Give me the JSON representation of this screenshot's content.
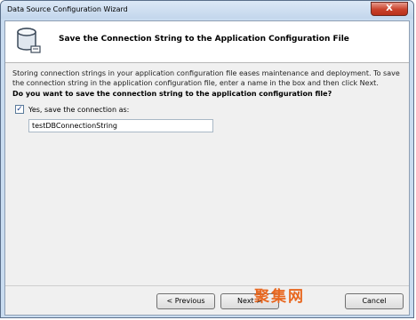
{
  "window": {
    "title": "Data Source Configuration Wizard",
    "close_glyph": "X"
  },
  "header": {
    "title": "Save the Connection String to the Application Configuration File",
    "icon": "database-icon"
  },
  "content": {
    "description": "Storing connection strings in your application configuration file eases maintenance and deployment. To save the connection string in the application configuration file, enter a name in the box and then click Next.",
    "question": "Do you want to save the connection string to the application configuration file?",
    "checkbox": {
      "checked": true,
      "mark": "✓",
      "label": "Yes, save the connection as:"
    },
    "connection_name": "testDBConnectionString"
  },
  "buttons": {
    "previous": "< Previous",
    "next": "Next >",
    "cancel": "Cancel"
  },
  "watermark": "聚集网"
}
